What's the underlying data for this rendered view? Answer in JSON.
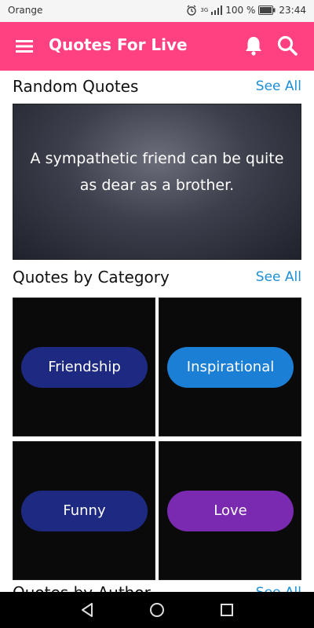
{
  "status_bar": {
    "carrier": "Orange",
    "battery_text": "100 %",
    "time": "23:44",
    "network_badge": "3G"
  },
  "app_bar": {
    "title": "Quotes For Live"
  },
  "random": {
    "heading": "Random Quotes",
    "see_all": "See All",
    "quote_text": "A sympathetic friend can be quite as dear as a brother."
  },
  "category": {
    "heading": "Quotes by Category",
    "see_all": "See All",
    "items": [
      {
        "label": "Friendship",
        "color": "#1e2a82"
      },
      {
        "label": "Inspirational",
        "color": "#1b7fd6"
      },
      {
        "label": "Funny",
        "color": "#1e2a82"
      },
      {
        "label": "Love",
        "color": "#7a2ab0"
      }
    ]
  },
  "author": {
    "heading": "Quotes by Author",
    "see_all": "See All"
  },
  "colors": {
    "app_bar": "#ff4081",
    "accent_link": "#1d8fd6"
  }
}
